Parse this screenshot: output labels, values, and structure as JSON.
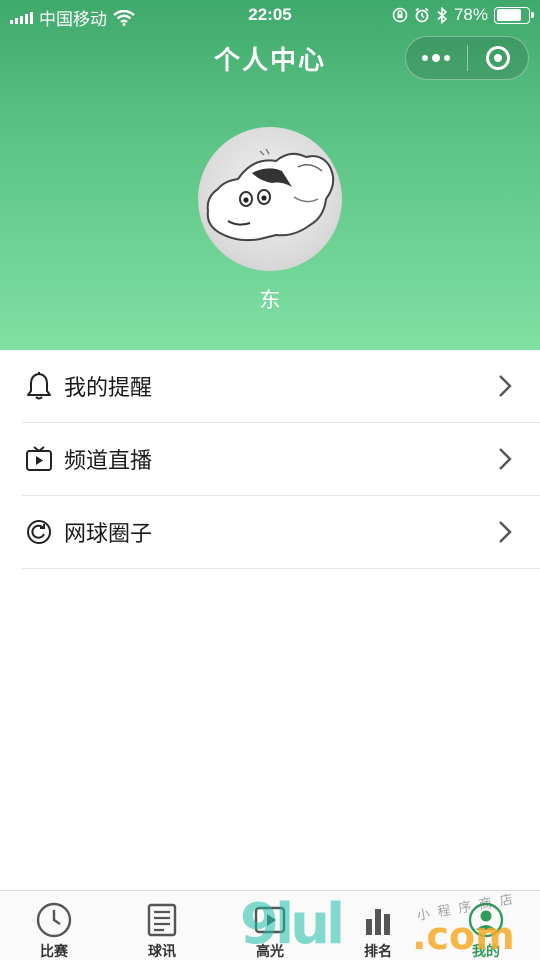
{
  "status_bar": {
    "carrier": "中国移动",
    "time": "22:05",
    "battery": "78%",
    "battery_level": 0.78
  },
  "nav": {
    "title": "个人中心"
  },
  "profile": {
    "username": "东"
  },
  "menu": [
    {
      "label": "我的提醒",
      "icon": "bell-icon"
    },
    {
      "label": "频道直播",
      "icon": "tv-play-icon"
    },
    {
      "label": "网球圈子",
      "icon": "circle-arrow-icon"
    }
  ],
  "tabbar": [
    {
      "label": "比赛",
      "icon": "clock-icon"
    },
    {
      "label": "球讯",
      "icon": "news-icon"
    },
    {
      "label": "高光",
      "icon": "video-icon"
    },
    {
      "label": "排名",
      "icon": "ranking-icon"
    },
    {
      "label": "我的",
      "icon": "user-icon",
      "active": true
    }
  ],
  "watermark": {
    "big": "9lul",
    "com": ".com",
    "small": "小程序商店"
  },
  "colors": {
    "header_top": "#3fa96b",
    "header_bottom": "#7fe0a2",
    "active_tab": "#2e9b5b"
  }
}
